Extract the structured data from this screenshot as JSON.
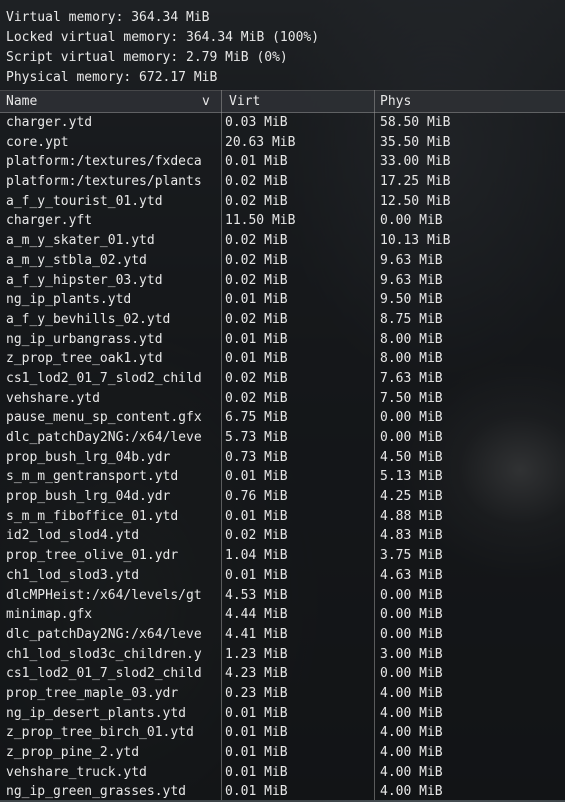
{
  "stats": {
    "virtual": "Virtual memory: 364.34 MiB",
    "locked": "Locked virtual memory: 364.34 MiB (100%)",
    "script": "Script virtual memory: 2.79 MiB (0%)",
    "physical": "Physical memory: 672.17 MiB"
  },
  "table": {
    "headers": {
      "name": "Name",
      "sort_indicator": "v",
      "virt": "Virt",
      "phys": "Phys"
    },
    "rows": [
      {
        "name": "charger.ytd",
        "virt": "0.03 MiB",
        "phys": "58.50 MiB"
      },
      {
        "name": "core.ypt",
        "virt": "20.63 MiB",
        "phys": "35.50 MiB"
      },
      {
        "name": "platform:/textures/fxdeca",
        "virt": "0.01 MiB",
        "phys": "33.00 MiB"
      },
      {
        "name": "platform:/textures/plants",
        "virt": "0.02 MiB",
        "phys": "17.25 MiB"
      },
      {
        "name": "a_f_y_tourist_01.ytd",
        "virt": "0.02 MiB",
        "phys": "12.50 MiB"
      },
      {
        "name": "charger.yft",
        "virt": "11.50 MiB",
        "phys": "0.00 MiB"
      },
      {
        "name": "a_m_y_skater_01.ytd",
        "virt": "0.02 MiB",
        "phys": "10.13 MiB"
      },
      {
        "name": "a_m_y_stbla_02.ytd",
        "virt": "0.02 MiB",
        "phys": "9.63 MiB"
      },
      {
        "name": "a_f_y_hipster_03.ytd",
        "virt": "0.02 MiB",
        "phys": "9.63 MiB"
      },
      {
        "name": "ng_ip_plants.ytd",
        "virt": "0.01 MiB",
        "phys": "9.50 MiB"
      },
      {
        "name": "a_f_y_bevhills_02.ytd",
        "virt": "0.02 MiB",
        "phys": "8.75 MiB"
      },
      {
        "name": "ng_ip_urbangrass.ytd",
        "virt": "0.01 MiB",
        "phys": "8.00 MiB"
      },
      {
        "name": "z_prop_tree_oak1.ytd",
        "virt": "0.01 MiB",
        "phys": "8.00 MiB"
      },
      {
        "name": "cs1_lod2_01_7_slod2_child",
        "virt": "0.02 MiB",
        "phys": "7.63 MiB"
      },
      {
        "name": "vehshare.ytd",
        "virt": "0.02 MiB",
        "phys": "7.50 MiB"
      },
      {
        "name": "pause_menu_sp_content.gfx",
        "virt": "6.75 MiB",
        "phys": "0.00 MiB"
      },
      {
        "name": "dlc_patchDay2NG:/x64/leve",
        "virt": "5.73 MiB",
        "phys": "0.00 MiB"
      },
      {
        "name": "prop_bush_lrg_04b.ydr",
        "virt": "0.73 MiB",
        "phys": "4.50 MiB"
      },
      {
        "name": "s_m_m_gentransport.ytd",
        "virt": "0.01 MiB",
        "phys": "5.13 MiB"
      },
      {
        "name": "prop_bush_lrg_04d.ydr",
        "virt": "0.76 MiB",
        "phys": "4.25 MiB"
      },
      {
        "name": "s_m_m_fiboffice_01.ytd",
        "virt": "0.01 MiB",
        "phys": "4.88 MiB"
      },
      {
        "name": "id2_lod_slod4.ytd",
        "virt": "0.02 MiB",
        "phys": "4.83 MiB"
      },
      {
        "name": "prop_tree_olive_01.ydr",
        "virt": "1.04 MiB",
        "phys": "3.75 MiB"
      },
      {
        "name": "ch1_lod_slod3.ytd",
        "virt": "0.01 MiB",
        "phys": "4.63 MiB"
      },
      {
        "name": "dlcMPHeist:/x64/levels/gt",
        "virt": "4.53 MiB",
        "phys": "0.00 MiB"
      },
      {
        "name": "minimap.gfx",
        "virt": "4.44 MiB",
        "phys": "0.00 MiB"
      },
      {
        "name": "dlc_patchDay2NG:/x64/leve",
        "virt": "4.41 MiB",
        "phys": "0.00 MiB"
      },
      {
        "name": "ch1_lod_slod3c_children.y",
        "virt": "1.23 MiB",
        "phys": "3.00 MiB"
      },
      {
        "name": "cs1_lod2_01_7_slod2_child",
        "virt": "4.23 MiB",
        "phys": "0.00 MiB"
      },
      {
        "name": "prop_tree_maple_03.ydr",
        "virt": "0.23 MiB",
        "phys": "4.00 MiB"
      },
      {
        "name": "ng_ip_desert_plants.ytd",
        "virt": "0.01 MiB",
        "phys": "4.00 MiB"
      },
      {
        "name": "z_prop_tree_birch_01.ytd",
        "virt": "0.01 MiB",
        "phys": "4.00 MiB"
      },
      {
        "name": "z_prop_pine_2.ytd",
        "virt": "0.01 MiB",
        "phys": "4.00 MiB"
      },
      {
        "name": "vehshare_truck.ytd",
        "virt": "0.01 MiB",
        "phys": "4.00 MiB"
      },
      {
        "name": "ng_ip_green_grasses.ytd",
        "virt": "0.01 MiB",
        "phys": "4.00 MiB"
      }
    ]
  }
}
